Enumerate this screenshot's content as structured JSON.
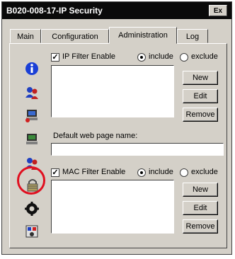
{
  "window": {
    "title": "B020-008-17-IP Security",
    "title_button": "Ex"
  },
  "tabs": [
    {
      "label": "Main"
    },
    {
      "label": "Configuration"
    },
    {
      "label": "Administration"
    },
    {
      "label": "Log"
    }
  ],
  "active_tab": "Administration",
  "sidebar_icons": [
    "info-icon",
    "users-icon",
    "computer-config-icon",
    "computer-icon",
    "user-remove-icon",
    "lock-icon",
    "gear-icon",
    "security-device-icon"
  ],
  "highlighted_icon": "lock-icon",
  "ip_filter": {
    "enable_label": "IP Filter Enable",
    "include_label": "include",
    "exclude_label": "exclude",
    "new_label": "New",
    "edit_label": "Edit",
    "remove_label": "Remove"
  },
  "default_page": {
    "label": "Default web page name:",
    "value": ""
  },
  "mac_filter": {
    "enable_label": "MAC Filter Enable",
    "include_label": "include",
    "exclude_label": "exclude",
    "new_label": "New",
    "edit_label": "Edit",
    "remove_label": "Remove"
  },
  "colors": {
    "highlight_ring": "#e01020",
    "titlebar": "#0a0a0a",
    "window_face": "#d4d0c8"
  }
}
